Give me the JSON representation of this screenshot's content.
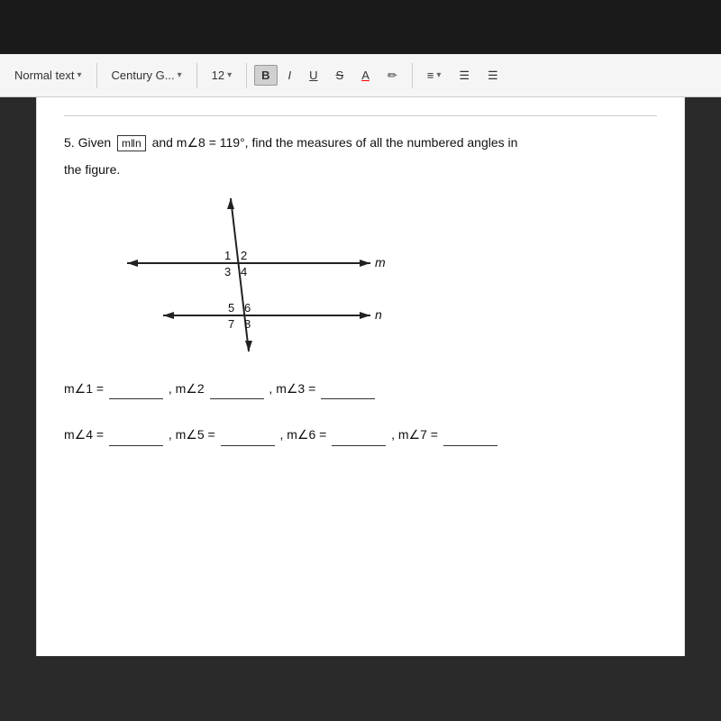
{
  "topbar": {
    "bg": "#1a1a1a"
  },
  "toolbar": {
    "style_label": "Normal text",
    "font_label": "Century G...",
    "size_label": "12",
    "bold_label": "B",
    "italic_label": "I",
    "underline_label": "U",
    "strikethrough_label": "S",
    "font_color_label": "A",
    "highlight_label": "✏",
    "align_label": "≡",
    "list1_label": "≡",
    "list2_label": "≡"
  },
  "problem": {
    "number": "5.",
    "given_text": "Given",
    "parallel_text": "m‖n",
    "condition": "and m∠8 = 119°, find the measures of all the numbered angles in",
    "continuation": "the figure."
  },
  "answers": {
    "row1": "m∠1 = _____ , m∠2 _____ , m∠3 = _____",
    "row2": "m∠4 = _____ , m∠5 = _____ , m∠6 = _____ , m∠7 = _____"
  },
  "diagram": {
    "line_m_label": "m",
    "line_n_label": "n",
    "angle_labels": [
      "1",
      "2",
      "3",
      "4",
      "5",
      "6",
      "7",
      "8"
    ]
  }
}
